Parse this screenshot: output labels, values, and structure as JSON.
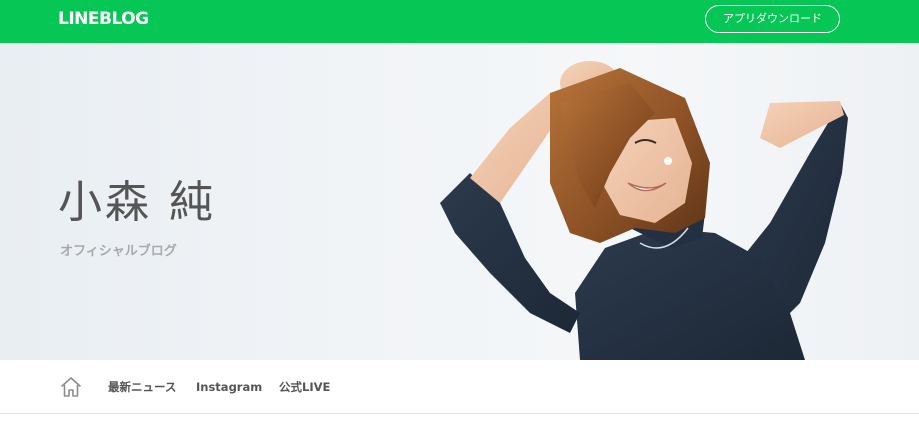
{
  "header": {
    "logo_text": "LINEBLOG",
    "app_download_label": "アプリダウンロード",
    "brand_color": "#06c755"
  },
  "hero": {
    "name": "小森 純",
    "subtitle": "オフィシャルブログ",
    "image": "portrait-photo"
  },
  "nav": {
    "home_icon": "home-icon",
    "items": [
      {
        "label": "最新ニュース"
      },
      {
        "label": "Instagram"
      },
      {
        "label": "公式LIVE"
      }
    ]
  }
}
